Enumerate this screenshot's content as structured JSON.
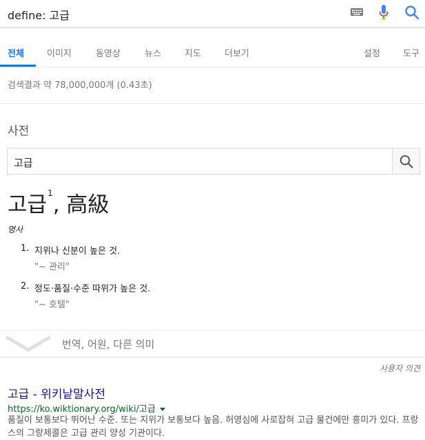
{
  "search": {
    "query": "define: 고급"
  },
  "colors": {
    "accent": "#1a73e8",
    "link": "#1a0dab",
    "url": "#006621"
  },
  "tabs": [
    {
      "label": "전체",
      "active": true
    },
    {
      "label": "이미지"
    },
    {
      "label": "동영상"
    },
    {
      "label": "뉴스"
    },
    {
      "label": "지도"
    },
    {
      "label": "더보기"
    },
    {
      "label": "설정"
    },
    {
      "label": "도구"
    }
  ],
  "result_stats": "검색결과 약 78,000,000개 (0.43초)",
  "dictionary": {
    "heading": "사전",
    "input_value": "고급",
    "headword": "고급",
    "superscript": "1",
    "hanja": ", 高級",
    "part_of_speech": "명사",
    "senses": [
      {
        "num": "1.",
        "definition": "지위나 신분이 높은 것.",
        "example": "\"~ 관리\""
      },
      {
        "num": "2.",
        "definition": "정도·품질·수준 따위가 높은 것.",
        "example": "\"~ 호텔\""
      }
    ],
    "more_label": "번역, 어원, 다른 의미"
  },
  "feedback": "사용자 의견",
  "result": {
    "title": "고급 - 위키낱말사전",
    "url": "https://ko.wiktionary.org/wiki/고급",
    "snippet": "품질이 보통보다 뛰어난 수준. 또는 지위가 보통보다 높음. 허영심에 사로잡혀 고급 물건에만 흥미가 있다. 프랑스의 그랑제콜은 고급 관리 양성 기관이다."
  }
}
